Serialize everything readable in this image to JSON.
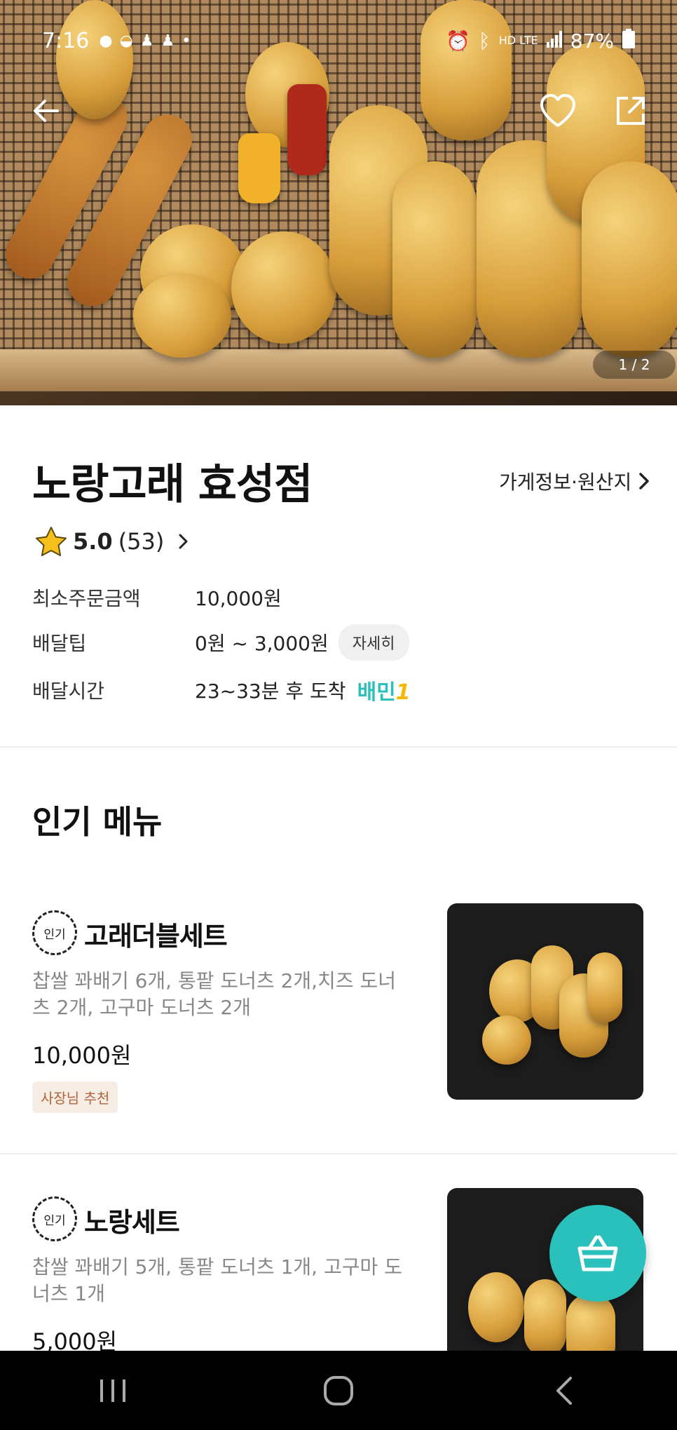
{
  "status_bar": {
    "time": "7:16",
    "signal_label": "HD LTE",
    "battery": "87%"
  },
  "hero": {
    "page_indicator": "1 / 2"
  },
  "store": {
    "name": "노랑고래 효성점",
    "info_link": "가게정보·원산지",
    "rating": "5.0",
    "review_count": "(53)",
    "min_order_label": "최소주문금액",
    "min_order_value": "10,000원",
    "delivery_tip_label": "배달팁",
    "delivery_tip_value": "0원 ~ 3,000원",
    "detail_button": "자세히",
    "delivery_time_label": "배달시간",
    "delivery_time_value": "23~33분 후 도착",
    "baemin_label": "배민",
    "baemin_one": "1"
  },
  "popular": {
    "title": "인기 메뉴",
    "badge": "인기",
    "items": [
      {
        "name": "고래더블세트",
        "desc": "찹쌀 꽈배기 6개, 통팥 도너츠 2개,치즈 도너츠 2개, 고구마 도너츠 2개",
        "price": "10,000원",
        "tag": "사장님 추천"
      },
      {
        "name": "노랑세트",
        "desc": "찹쌀 꽈배기 5개, 통팥 도너츠 1개, 고구마 도너츠 1개",
        "price": "5,000원"
      }
    ]
  },
  "colors": {
    "accent": "#2ac1bc",
    "navbar": "#000000"
  },
  "icons": [
    "back-arrow-icon",
    "heart-icon",
    "share-icon",
    "star-icon",
    "chevron-right-icon",
    "basket-icon",
    "recents-icon",
    "home-icon",
    "back-nav-icon"
  ]
}
